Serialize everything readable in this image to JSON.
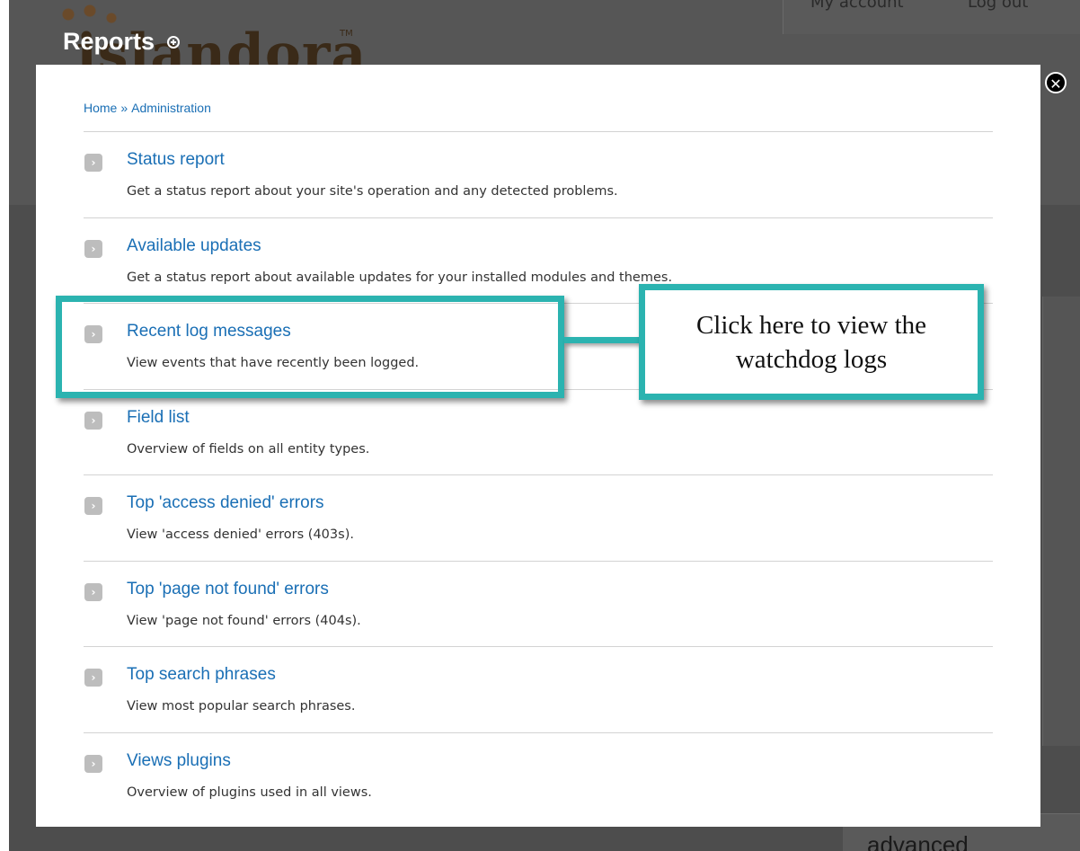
{
  "background": {
    "logo_text": "islandora",
    "logo_tm": "TM",
    "top_links": [
      "My account",
      "Log out"
    ],
    "bottom_text": "advanced"
  },
  "overlay": {
    "title": "Reports",
    "close_glyph": "✕"
  },
  "breadcrumb": {
    "home": "Home",
    "separator": "»",
    "admin": "Administration"
  },
  "items": [
    {
      "title": "Status report",
      "description": "Get a status report about your site's operation and any detected problems."
    },
    {
      "title": "Available updates",
      "description": "Get a status report about available updates for your installed modules and themes."
    },
    {
      "title": "Recent log messages",
      "description": "View events that have recently been logged."
    },
    {
      "title": "Field list",
      "description": "Overview of fields on all entity types."
    },
    {
      "title": "Top 'access denied' errors",
      "description": "View 'access denied' errors (403s)."
    },
    {
      "title": "Top 'page not found' errors",
      "description": "View 'page not found' errors (404s)."
    },
    {
      "title": "Top search phrases",
      "description": "View most popular search phrases."
    },
    {
      "title": "Views plugins",
      "description": "Overview of plugins used in all views."
    }
  ],
  "item_arrow_glyph": "›",
  "annotation": {
    "callout_text": "Click here to view the watchdog logs",
    "accent_color": "#2bb3b0"
  },
  "colors": {
    "link": "#1a6fb5",
    "overlay_dim": "#4d4d4d"
  }
}
